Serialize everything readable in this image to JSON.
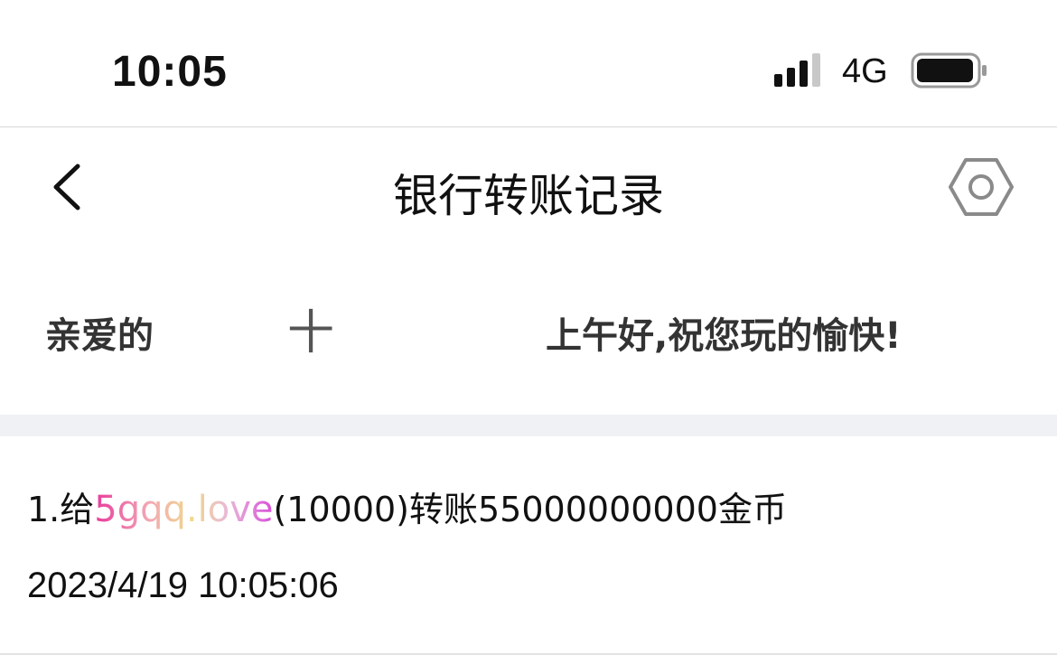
{
  "status_bar": {
    "time": "10:05",
    "network": "4G",
    "signal_icon": "cellular-signal-icon",
    "battery_icon": "battery-icon"
  },
  "nav": {
    "title": "银行转账记录",
    "back_icon": "chevron-left-icon",
    "settings_icon": "hexagon-settings-icon"
  },
  "greeting": {
    "left": "亲爱的",
    "plus": "十",
    "right": "上午好,祝您玩的愉快!"
  },
  "records": [
    {
      "prefix": "1.给",
      "recipient": "5gqq.love",
      "suffix": "(10000)转账55000000000金币",
      "time": "2023/4/19 10:05:06"
    }
  ],
  "colors": {
    "divider_band": "#f0f1f5",
    "recipient_gradient": [
      "#e83a9c",
      "#f2a6b3",
      "#f1d98d",
      "#e9b8d8",
      "#d94fd9"
    ]
  }
}
